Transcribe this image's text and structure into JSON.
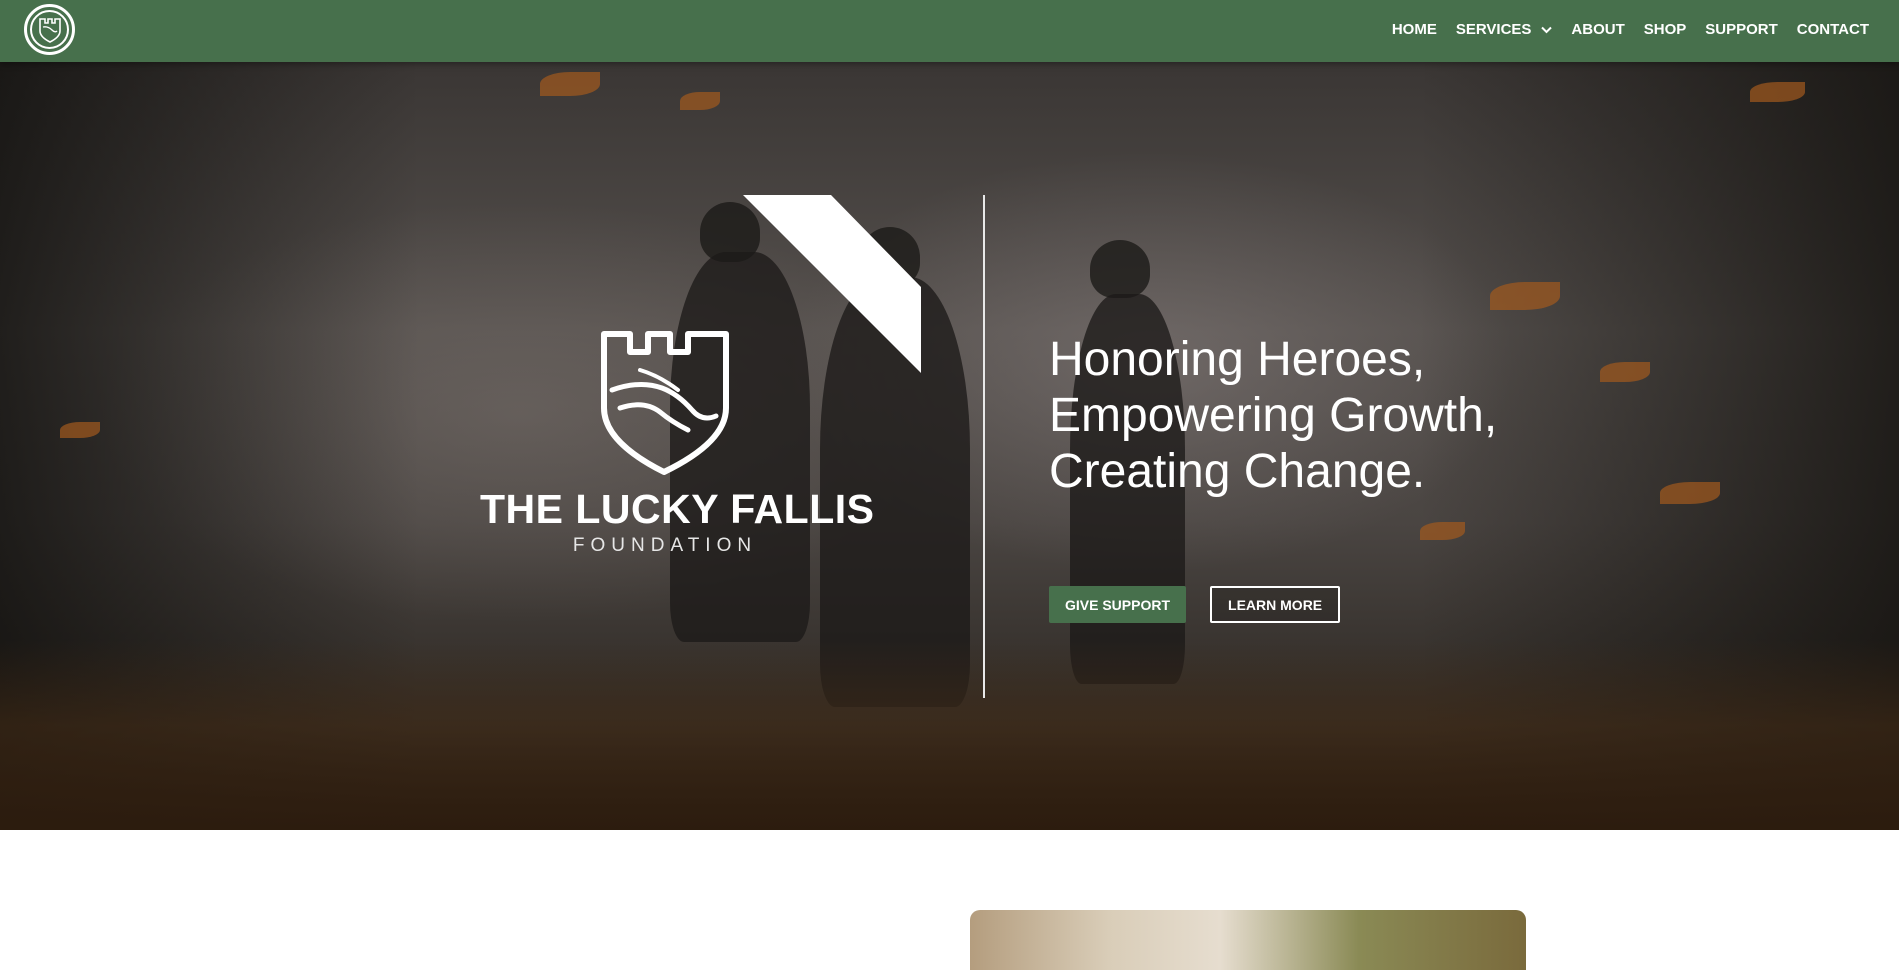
{
  "nav": {
    "logo_icon": "castle-handshake-logo",
    "items": [
      {
        "label": "HOME"
      },
      {
        "label": "SERVICES",
        "icon": "chevron-down-icon"
      },
      {
        "label": "ABOUT"
      },
      {
        "label": "SHOP"
      },
      {
        "label": "SUPPORT"
      },
      {
        "label": "CONTACT"
      }
    ]
  },
  "hero": {
    "brand": {
      "name": "THE LUCKY FALLIS",
      "sub": "FOUNDATION",
      "icon": "castle-handshake-icon"
    },
    "headline": {
      "line1": "Honoring Heroes,",
      "line2": "Empowering Growth,",
      "line3": "Creating Change."
    },
    "buttons": {
      "primary": "GIVE SUPPORT",
      "secondary": "LEARN MORE"
    }
  },
  "colors": {
    "brand_green": "#47704c",
    "white": "#ffffff"
  }
}
